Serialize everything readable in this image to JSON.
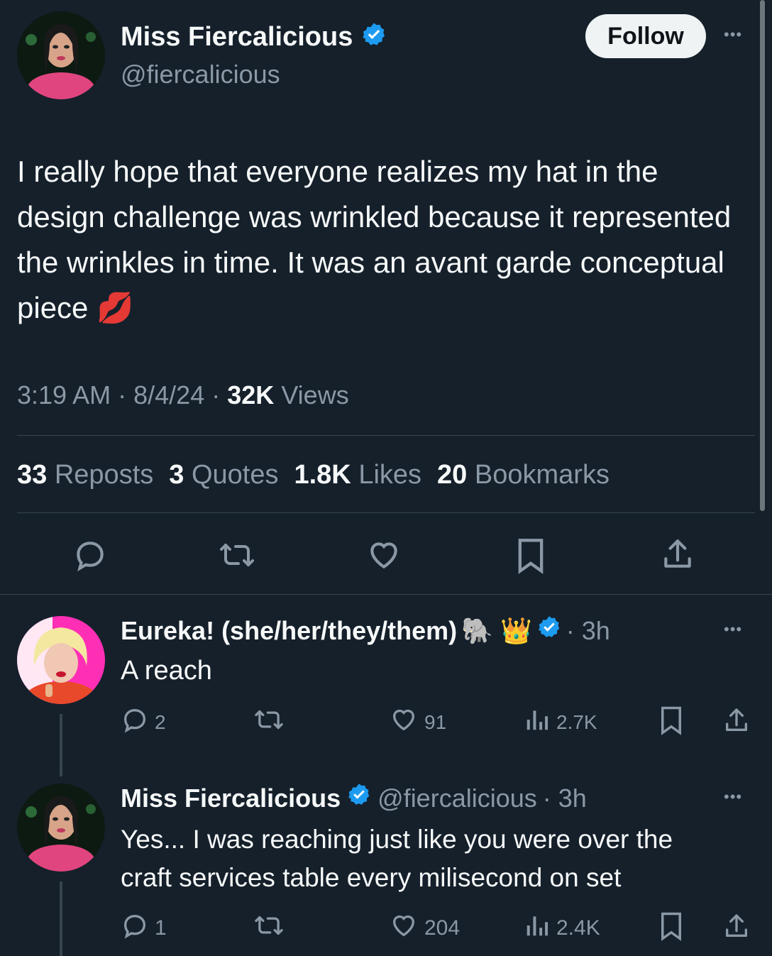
{
  "main_tweet": {
    "author_name": "Miss Fiercalicious",
    "author_handle": "@fiercalicious",
    "follow_label": "Follow",
    "more_label": "•••",
    "text": "I really hope that everyone realizes my hat in the design challenge was wrinkled because it represented the wrinkles in time. It was an avant garde conceptual piece",
    "emoji": "💋",
    "time": "3:19 AM",
    "date": "8/4/24",
    "sep": "·",
    "views_count": "32K",
    "views_label": "Views",
    "stats": [
      {
        "count": "33",
        "label": "Reposts"
      },
      {
        "count": "3",
        "label": "Quotes"
      },
      {
        "count": "1.8K",
        "label": "Likes"
      },
      {
        "count": "20",
        "label": "Bookmarks"
      }
    ]
  },
  "replies": [
    {
      "author_name": "Eureka! (she/her/they/them)",
      "name_emojis": "🐘 👑",
      "age": "· 3h",
      "more_label": "•••",
      "text": "A reach",
      "replies_count": "2",
      "likes_count": "91",
      "views_count": "2.7K"
    },
    {
      "author_name": "Miss Fiercalicious",
      "author_handle": "@fiercalicious",
      "age": "· 3h",
      "more_label": "•••",
      "text_line1": "Yes... I was reaching just like you were over the",
      "text_line2": "craft services table every milisecond on set",
      "replies_count": "1",
      "likes_count": "204",
      "views_count": "2.4K"
    }
  ],
  "colors": {
    "background": "#15202b",
    "text": "#f7f9f9",
    "muted": "#8b98a5",
    "verified": "#1d9bf0",
    "divider": "#38444d"
  },
  "icons": [
    "reply-icon",
    "repost-icon",
    "like-icon",
    "bookmark-icon",
    "share-icon",
    "views-icon",
    "verified-badge-icon",
    "more-icon"
  ]
}
